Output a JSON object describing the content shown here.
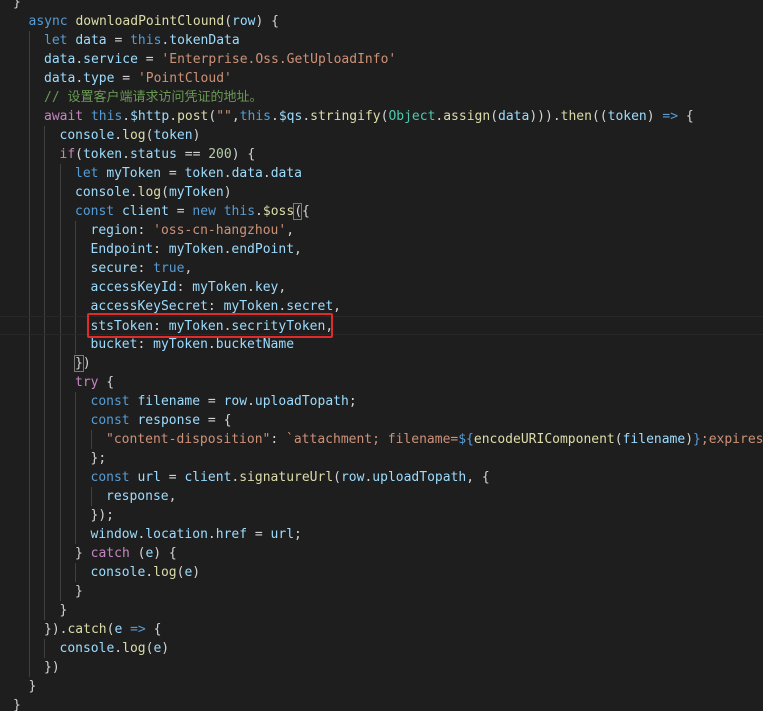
{
  "editor": {
    "language": "javascript",
    "highlight_color": "#e02b2b",
    "lines": [
      {
        "indent": 0,
        "tokens": [
          {
            "t": "}",
            "c": "punc"
          }
        ],
        "partial": true
      },
      {
        "indent": 1,
        "tokens": [
          {
            "t": "async ",
            "c": "kw"
          },
          {
            "t": "downloadPointClound",
            "c": "fn"
          },
          {
            "t": "(",
            "c": "punc"
          },
          {
            "t": "row",
            "c": "var"
          },
          {
            "t": ") {",
            "c": "punc"
          }
        ]
      },
      {
        "indent": 2,
        "tokens": [
          {
            "t": "let ",
            "c": "kw"
          },
          {
            "t": "data",
            "c": "var"
          },
          {
            "t": " = ",
            "c": "punc"
          },
          {
            "t": "this",
            "c": "kw"
          },
          {
            "t": ".",
            "c": "punc"
          },
          {
            "t": "tokenData",
            "c": "var"
          }
        ]
      },
      {
        "indent": 2,
        "tokens": [
          {
            "t": "data",
            "c": "var"
          },
          {
            "t": ".",
            "c": "punc"
          },
          {
            "t": "service",
            "c": "var"
          },
          {
            "t": " = ",
            "c": "punc"
          },
          {
            "t": "'Enterprise.Oss.GetUploadInfo'",
            "c": "str"
          }
        ]
      },
      {
        "indent": 2,
        "tokens": [
          {
            "t": "data",
            "c": "var"
          },
          {
            "t": ".",
            "c": "punc"
          },
          {
            "t": "type",
            "c": "var"
          },
          {
            "t": " = ",
            "c": "punc"
          },
          {
            "t": "'PointCloud'",
            "c": "str"
          }
        ]
      },
      {
        "indent": 2,
        "tokens": [
          {
            "t": "// 设置客户端请求访问凭证的地址。",
            "c": "cmt"
          }
        ]
      },
      {
        "indent": 2,
        "tokens": [
          {
            "t": "await ",
            "c": "ctrl"
          },
          {
            "t": "this",
            "c": "kw"
          },
          {
            "t": ".",
            "c": "punc"
          },
          {
            "t": "$http",
            "c": "var"
          },
          {
            "t": ".",
            "c": "punc"
          },
          {
            "t": "post",
            "c": "fn"
          },
          {
            "t": "(",
            "c": "punc"
          },
          {
            "t": "\"\"",
            "c": "str"
          },
          {
            "t": ",",
            "c": "punc"
          },
          {
            "t": "this",
            "c": "kw"
          },
          {
            "t": ".",
            "c": "punc"
          },
          {
            "t": "$qs",
            "c": "var"
          },
          {
            "t": ".",
            "c": "punc"
          },
          {
            "t": "stringify",
            "c": "fn"
          },
          {
            "t": "(",
            "c": "punc"
          },
          {
            "t": "Object",
            "c": "cls"
          },
          {
            "t": ".",
            "c": "punc"
          },
          {
            "t": "assign",
            "c": "fn"
          },
          {
            "t": "(",
            "c": "punc"
          },
          {
            "t": "data",
            "c": "var"
          },
          {
            "t": "))).",
            "c": "punc"
          },
          {
            "t": "then",
            "c": "fn"
          },
          {
            "t": "((",
            "c": "punc"
          },
          {
            "t": "token",
            "c": "var"
          },
          {
            "t": ") ",
            "c": "punc"
          },
          {
            "t": "=>",
            "c": "kw"
          },
          {
            "t": " {",
            "c": "punc"
          }
        ]
      },
      {
        "indent": 3,
        "tokens": [
          {
            "t": "console",
            "c": "var"
          },
          {
            "t": ".",
            "c": "punc"
          },
          {
            "t": "log",
            "c": "fn"
          },
          {
            "t": "(",
            "c": "punc"
          },
          {
            "t": "token",
            "c": "var"
          },
          {
            "t": ")",
            "c": "punc"
          }
        ]
      },
      {
        "indent": 3,
        "tokens": [
          {
            "t": "if",
            "c": "ctrl"
          },
          {
            "t": "(",
            "c": "punc"
          },
          {
            "t": "token",
            "c": "var"
          },
          {
            "t": ".",
            "c": "punc"
          },
          {
            "t": "status",
            "c": "var"
          },
          {
            "t": " == ",
            "c": "punc"
          },
          {
            "t": "200",
            "c": "num"
          },
          {
            "t": ") {",
            "c": "punc"
          }
        ]
      },
      {
        "indent": 4,
        "tokens": [
          {
            "t": "let ",
            "c": "kw"
          },
          {
            "t": "myToken",
            "c": "var"
          },
          {
            "t": " = ",
            "c": "punc"
          },
          {
            "t": "token",
            "c": "var"
          },
          {
            "t": ".",
            "c": "punc"
          },
          {
            "t": "data",
            "c": "var"
          },
          {
            "t": ".",
            "c": "punc"
          },
          {
            "t": "data",
            "c": "var"
          }
        ]
      },
      {
        "indent": 4,
        "tokens": [
          {
            "t": "console",
            "c": "var"
          },
          {
            "t": ".",
            "c": "punc"
          },
          {
            "t": "log",
            "c": "fn"
          },
          {
            "t": "(",
            "c": "punc"
          },
          {
            "t": "myToken",
            "c": "var"
          },
          {
            "t": ")",
            "c": "punc"
          }
        ]
      },
      {
        "indent": 4,
        "tokens": [
          {
            "t": "const ",
            "c": "kw"
          },
          {
            "t": "client",
            "c": "var"
          },
          {
            "t": " = ",
            "c": "punc"
          },
          {
            "t": "new ",
            "c": "kw"
          },
          {
            "t": "this",
            "c": "kw"
          },
          {
            "t": ".",
            "c": "punc"
          },
          {
            "t": "$oss",
            "c": "fn"
          },
          {
            "t": "(",
            "c": "punc"
          },
          {
            "t": "{",
            "c": "punc"
          }
        ]
      },
      {
        "indent": 5,
        "tokens": [
          {
            "t": "region",
            "c": "var"
          },
          {
            "t": ": ",
            "c": "punc"
          },
          {
            "t": "'oss-cn-hangzhou'",
            "c": "str"
          },
          {
            "t": ",",
            "c": "punc"
          }
        ]
      },
      {
        "indent": 5,
        "tokens": [
          {
            "t": "Endpoint",
            "c": "var"
          },
          {
            "t": ": ",
            "c": "punc"
          },
          {
            "t": "myToken",
            "c": "var"
          },
          {
            "t": ".",
            "c": "punc"
          },
          {
            "t": "endPoint",
            "c": "var"
          },
          {
            "t": ",",
            "c": "punc"
          }
        ]
      },
      {
        "indent": 5,
        "tokens": [
          {
            "t": "secure",
            "c": "var"
          },
          {
            "t": ": ",
            "c": "punc"
          },
          {
            "t": "true",
            "c": "kw"
          },
          {
            "t": ",",
            "c": "punc"
          }
        ]
      },
      {
        "indent": 5,
        "tokens": [
          {
            "t": "accessKeyId",
            "c": "var"
          },
          {
            "t": ": ",
            "c": "punc"
          },
          {
            "t": "myToken",
            "c": "var"
          },
          {
            "t": ".",
            "c": "punc"
          },
          {
            "t": "key",
            "c": "var"
          },
          {
            "t": ",",
            "c": "punc"
          }
        ]
      },
      {
        "indent": 5,
        "tokens": [
          {
            "t": "accessKeySecret",
            "c": "var"
          },
          {
            "t": ": ",
            "c": "punc"
          },
          {
            "t": "myToken",
            "c": "var"
          },
          {
            "t": ".",
            "c": "punc"
          },
          {
            "t": "secret",
            "c": "var"
          },
          {
            "t": ",",
            "c": "punc"
          }
        ]
      },
      {
        "indent": 5,
        "active": true,
        "tokens": [
          {
            "t": "stsToken",
            "c": "var"
          },
          {
            "t": ": ",
            "c": "punc"
          },
          {
            "t": "myToken",
            "c": "var"
          },
          {
            "t": ".",
            "c": "punc"
          },
          {
            "t": "secrityToken",
            "c": "var"
          },
          {
            "t": ",",
            "c": "punc"
          }
        ]
      },
      {
        "indent": 5,
        "tokens": [
          {
            "t": "bucket",
            "c": "var"
          },
          {
            "t": ": ",
            "c": "punc"
          },
          {
            "t": "myToken",
            "c": "var"
          },
          {
            "t": ".",
            "c": "punc"
          },
          {
            "t": "bucketName",
            "c": "var"
          }
        ]
      },
      {
        "indent": 4,
        "tokens": [
          {
            "t": "}",
            "c": "punc"
          },
          {
            "t": ")",
            "c": "punc"
          }
        ]
      },
      {
        "indent": 4,
        "tokens": [
          {
            "t": "try",
            "c": "ctrl"
          },
          {
            "t": " {",
            "c": "punc"
          }
        ]
      },
      {
        "indent": 5,
        "tokens": [
          {
            "t": "const ",
            "c": "kw"
          },
          {
            "t": "filename",
            "c": "var"
          },
          {
            "t": " = ",
            "c": "punc"
          },
          {
            "t": "row",
            "c": "var"
          },
          {
            "t": ".",
            "c": "punc"
          },
          {
            "t": "uploadTopath",
            "c": "var"
          },
          {
            "t": ";",
            "c": "punc"
          }
        ]
      },
      {
        "indent": 5,
        "tokens": [
          {
            "t": "const ",
            "c": "kw"
          },
          {
            "t": "response",
            "c": "var"
          },
          {
            "t": " = {",
            "c": "punc"
          }
        ]
      },
      {
        "indent": 6,
        "tokens": [
          {
            "t": "\"content-disposition\"",
            "c": "str"
          },
          {
            "t": ": ",
            "c": "punc"
          },
          {
            "t": "`attachment; filename=",
            "c": "str"
          },
          {
            "t": "${",
            "c": "tpl"
          },
          {
            "t": "encodeURIComponent",
            "c": "fn"
          },
          {
            "t": "(",
            "c": "punc"
          },
          {
            "t": "filename",
            "c": "var"
          },
          {
            "t": ")",
            "c": "punc"
          },
          {
            "t": "}",
            "c": "tpl"
          },
          {
            "t": ";expires:",
            "c": "str"
          }
        ]
      },
      {
        "indent": 5,
        "tokens": [
          {
            "t": "};",
            "c": "punc"
          }
        ]
      },
      {
        "indent": 5,
        "tokens": [
          {
            "t": "const ",
            "c": "kw"
          },
          {
            "t": "url",
            "c": "var"
          },
          {
            "t": " = ",
            "c": "punc"
          },
          {
            "t": "client",
            "c": "var"
          },
          {
            "t": ".",
            "c": "punc"
          },
          {
            "t": "signatureUrl",
            "c": "fn"
          },
          {
            "t": "(",
            "c": "punc"
          },
          {
            "t": "row",
            "c": "var"
          },
          {
            "t": ".",
            "c": "punc"
          },
          {
            "t": "uploadTopath",
            "c": "var"
          },
          {
            "t": ", {",
            "c": "punc"
          }
        ]
      },
      {
        "indent": 6,
        "tokens": [
          {
            "t": "response",
            "c": "var"
          },
          {
            "t": ",",
            "c": "punc"
          }
        ]
      },
      {
        "indent": 5,
        "tokens": [
          {
            "t": "});",
            "c": "punc"
          }
        ]
      },
      {
        "indent": 5,
        "tokens": [
          {
            "t": "window",
            "c": "var"
          },
          {
            "t": ".",
            "c": "punc"
          },
          {
            "t": "location",
            "c": "var"
          },
          {
            "t": ".",
            "c": "punc"
          },
          {
            "t": "href",
            "c": "var"
          },
          {
            "t": " = ",
            "c": "punc"
          },
          {
            "t": "url",
            "c": "var"
          },
          {
            "t": ";",
            "c": "punc"
          }
        ]
      },
      {
        "indent": 4,
        "tokens": [
          {
            "t": "} ",
            "c": "punc"
          },
          {
            "t": "catch",
            "c": "ctrl"
          },
          {
            "t": " (",
            "c": "punc"
          },
          {
            "t": "e",
            "c": "var"
          },
          {
            "t": ") {",
            "c": "punc"
          }
        ]
      },
      {
        "indent": 5,
        "tokens": [
          {
            "t": "console",
            "c": "var"
          },
          {
            "t": ".",
            "c": "punc"
          },
          {
            "t": "log",
            "c": "fn"
          },
          {
            "t": "(",
            "c": "punc"
          },
          {
            "t": "e",
            "c": "var"
          },
          {
            "t": ")",
            "c": "punc"
          }
        ]
      },
      {
        "indent": 4,
        "tokens": [
          {
            "t": "}",
            "c": "punc"
          }
        ]
      },
      {
        "indent": 3,
        "tokens": [
          {
            "t": "}",
            "c": "punc"
          }
        ]
      },
      {
        "indent": 2,
        "tokens": [
          {
            "t": "}).",
            "c": "punc"
          },
          {
            "t": "catch",
            "c": "fn"
          },
          {
            "t": "(",
            "c": "punc"
          },
          {
            "t": "e",
            "c": "var"
          },
          {
            "t": " ",
            "c": "punc"
          },
          {
            "t": "=>",
            "c": "kw"
          },
          {
            "t": " {",
            "c": "punc"
          }
        ]
      },
      {
        "indent": 3,
        "tokens": [
          {
            "t": "console",
            "c": "var"
          },
          {
            "t": ".",
            "c": "punc"
          },
          {
            "t": "log",
            "c": "fn"
          },
          {
            "t": "(",
            "c": "punc"
          },
          {
            "t": "e",
            "c": "var"
          },
          {
            "t": ")",
            "c": "punc"
          }
        ]
      },
      {
        "indent": 2,
        "tokens": [
          {
            "t": "})",
            "c": "punc"
          }
        ]
      },
      {
        "indent": 1,
        "tokens": [
          {
            "t": "}",
            "c": "punc"
          }
        ]
      },
      {
        "indent": 0,
        "tokens": [
          {
            "t": "}",
            "c": "punc"
          }
        ]
      }
    ]
  }
}
